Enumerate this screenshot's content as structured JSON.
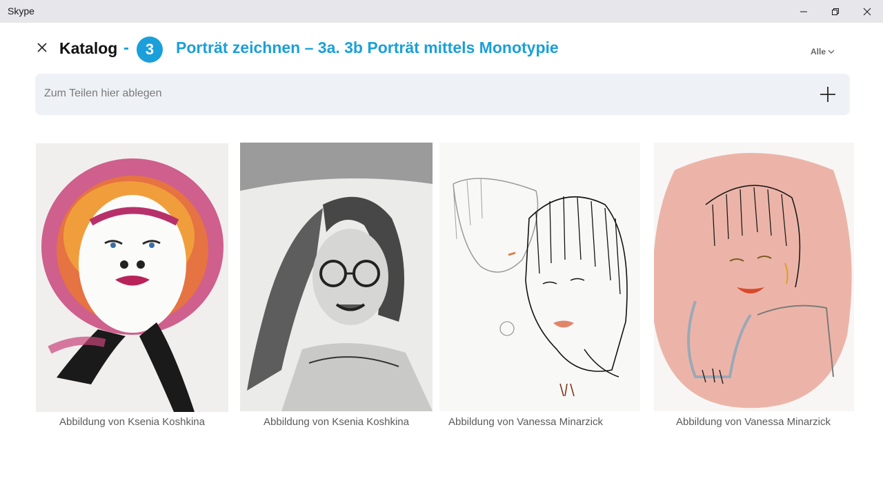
{
  "window": {
    "title": "Skype",
    "controls": {
      "minimize": "minimize-icon",
      "restore": "restore-icon",
      "close": "close-icon"
    }
  },
  "header": {
    "title": "Katalog",
    "separator": "-",
    "number": "3",
    "topic": "Porträt zeichnen – 3a. 3b Porträt mittels Monotypie",
    "filter_label": "Alle",
    "accent_color": "#1a9fdb"
  },
  "dropzone": {
    "placeholder": "Zum Teilen hier ablegen",
    "add_icon": "plus-icon"
  },
  "gallery": [
    {
      "caption": "Abbildung  von Ksenia Koshkina"
    },
    {
      "caption": "Abbildung  von Ksenia Koshkina"
    },
    {
      "caption": "Abbildung  von Vanessa Minarzick"
    },
    {
      "caption": "Abbildung  von Vanessa Minarzick"
    }
  ]
}
